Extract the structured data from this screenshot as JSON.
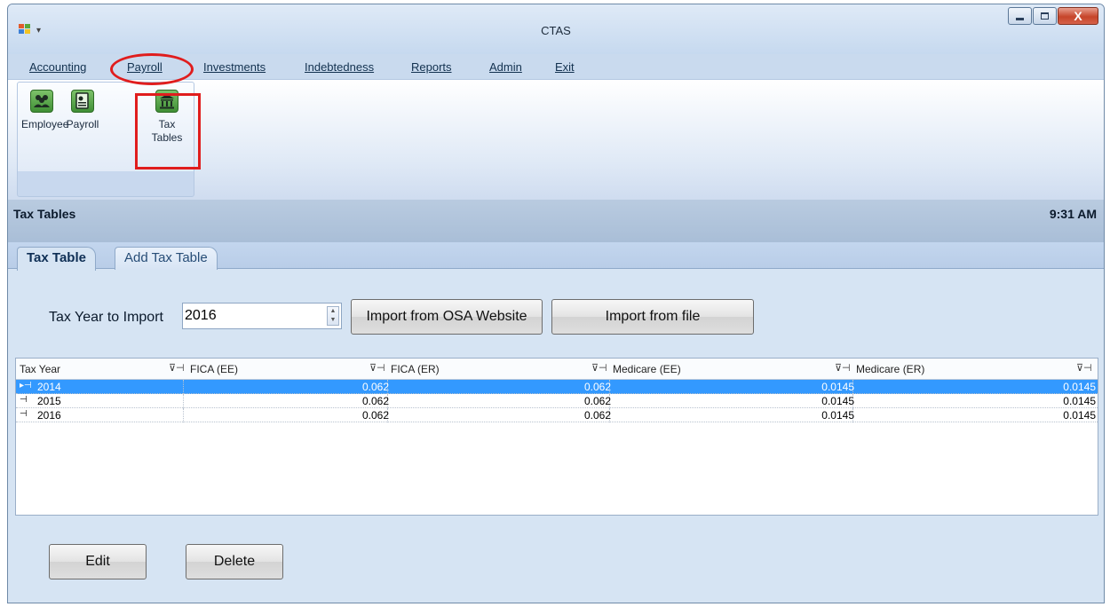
{
  "window": {
    "title": "CTAS",
    "close_glyph": "X"
  },
  "menu": [
    "Accounting",
    "Payroll",
    "Investments",
    "Indebtedness",
    "Reports",
    "Admin",
    "Exit"
  ],
  "ribbon": {
    "employee_label": "Employee",
    "payroll_label": "Payroll",
    "tax_tables_label_1": "Tax",
    "tax_tables_label_2": "Tables"
  },
  "header": {
    "title": "Tax Tables",
    "clock": "9:31 AM"
  },
  "tabs": [
    "Tax Table",
    "Add Tax Table"
  ],
  "import": {
    "label": "Tax Year to Import",
    "year": "2016",
    "osa_button": "Import from OSA Website",
    "file_button": "Import from file"
  },
  "grid": {
    "columns": [
      "Tax Year",
      "FICA (EE)",
      "FICA (ER)",
      "Medicare (EE)",
      "Medicare (ER)"
    ],
    "rows": [
      {
        "year": "2014",
        "fica_ee": "0.062",
        "fica_er": "0.062",
        "medicare_ee": "0.0145",
        "medicare_er": "0.0145",
        "selected": true
      },
      {
        "year": "2015",
        "fica_ee": "0.062",
        "fica_er": "0.062",
        "medicare_ee": "0.0145",
        "medicare_er": "0.0145",
        "selected": false
      },
      {
        "year": "2016",
        "fica_ee": "0.062",
        "fica_er": "0.062",
        "medicare_ee": "0.0145",
        "medicare_er": "0.0145",
        "selected": false
      }
    ]
  },
  "actions": {
    "edit": "Edit",
    "delete": "Delete"
  },
  "colors": {
    "selection": "#3399ff",
    "annotation": "#e01d1d",
    "ribbon_tile": "#3f8f35"
  }
}
